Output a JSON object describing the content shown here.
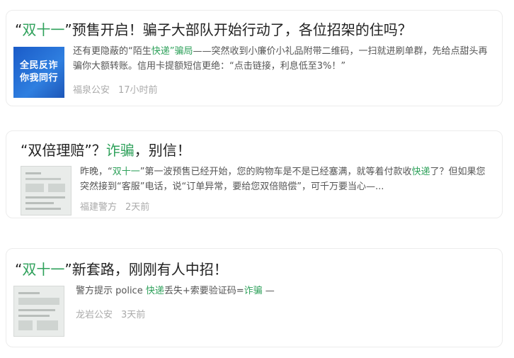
{
  "articles": [
    {
      "title": {
        "q_open": "“",
        "highlight": "双十一",
        "rest": "”预售开启！骗子大部队开始行动了，各位招架的住吗？"
      },
      "thumb": {
        "line1": "全民反诈",
        "line2": "你我同行"
      },
      "summary": {
        "p1": "还有更隐蔽的“陌生",
        "hl1": "快递",
        "hl2": "”骗局",
        "p2": "——突然收到小廉价小礼品附带二维码，一扫就进刷单群，先给点甜头再骗你大额转账。信用卡提额短信更绝：“点击链接，利息低至3%！”"
      },
      "source": "福泉公安",
      "time": "17小时前"
    },
    {
      "title": {
        "q_open": "“双倍理赔”？",
        "highlight": "诈骗",
        "rest": "，别信！"
      },
      "summary": {
        "p1": "昨晚，“",
        "hl1": "双十一",
        "p2": "”第一波预售已经开始，您的购物车是不是已经塞满，就等着付款收",
        "hl2": "快递",
        "p3": "了？但如果您突然接到“客服”电话，说“订单异常，要给您双倍赔偿”，可千万要当心—..."
      },
      "source": "福建警方",
      "time": "2天前"
    },
    {
      "title": {
        "q_open": "“",
        "highlight": "双十一",
        "rest": "”新套路，刚刚有人中招！"
      },
      "summary": {
        "p1": "警方提示 police ",
        "hl1": "快递",
        "p2": "丢失+索要验证码=",
        "hl2": "诈骗",
        "p3": " —"
      },
      "source": "龙岩公安",
      "time": "3天前"
    }
  ],
  "colors": {
    "highlight": "#2fa15b",
    "meta": "#aaaaaa",
    "thumb_blue": "#1f63d1"
  }
}
